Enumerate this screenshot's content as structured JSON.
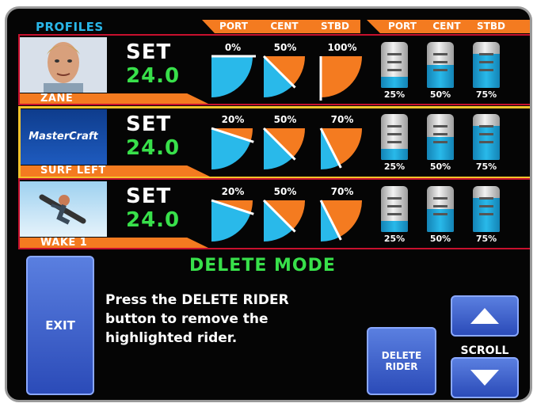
{
  "header": {
    "title": "PROFILES",
    "group1": [
      "PORT",
      "CENT",
      "STBD"
    ],
    "group2": [
      "PORT",
      "CENT",
      "STBD"
    ]
  },
  "riders": [
    {
      "name": "ZANE",
      "set_label": "SET",
      "set_value": "24.0",
      "photo": "rider-portrait",
      "highlighted": false,
      "gauges": [
        {
          "label": "0%",
          "value": 0
        },
        {
          "label": "50%",
          "value": 50
        },
        {
          "label": "100%",
          "value": 100
        }
      ],
      "tanks": [
        {
          "label": "25%",
          "value": 25
        },
        {
          "label": "50%",
          "value": 50
        },
        {
          "label": "75%",
          "value": 75
        }
      ]
    },
    {
      "name": "SURF LEFT",
      "set_label": "SET",
      "set_value": "24.0",
      "photo": "mastercraft-logo",
      "logo_text": "MasterCraft",
      "highlighted": true,
      "gauges": [
        {
          "label": "20%",
          "value": 20
        },
        {
          "label": "50%",
          "value": 50
        },
        {
          "label": "70%",
          "value": 70
        }
      ],
      "tanks": [
        {
          "label": "25%",
          "value": 25
        },
        {
          "label": "50%",
          "value": 50
        },
        {
          "label": "75%",
          "value": 75
        }
      ]
    },
    {
      "name": "WAKE 1",
      "set_label": "SET",
      "set_value": "24.0",
      "photo": "wakeboarder-photo",
      "highlighted": false,
      "gauges": [
        {
          "label": "20%",
          "value": 20
        },
        {
          "label": "50%",
          "value": 50
        },
        {
          "label": "70%",
          "value": 70
        }
      ],
      "tanks": [
        {
          "label": "25%",
          "value": 25
        },
        {
          "label": "50%",
          "value": 50
        },
        {
          "label": "75%",
          "value": 75
        }
      ]
    }
  ],
  "mode_title": "DELETE MODE",
  "exit_label": "EXIT",
  "instructions": [
    "Press the DELETE RIDER",
    "button to remove the",
    "highlighted rider."
  ],
  "delete_rider_label": [
    "DELETE",
    "RIDER"
  ],
  "scroll_label": "SCROLL",
  "icons": {
    "up": "arrow-up-icon",
    "down": "arrow-down-icon"
  },
  "colors": {
    "accent_orange": "#f47b20",
    "tank_blue": "#29b9ea",
    "highlight": "#f6c42b",
    "row_border": "#c8102e",
    "value_green": "#38e04a",
    "button_blue": "#3b5fd0"
  }
}
